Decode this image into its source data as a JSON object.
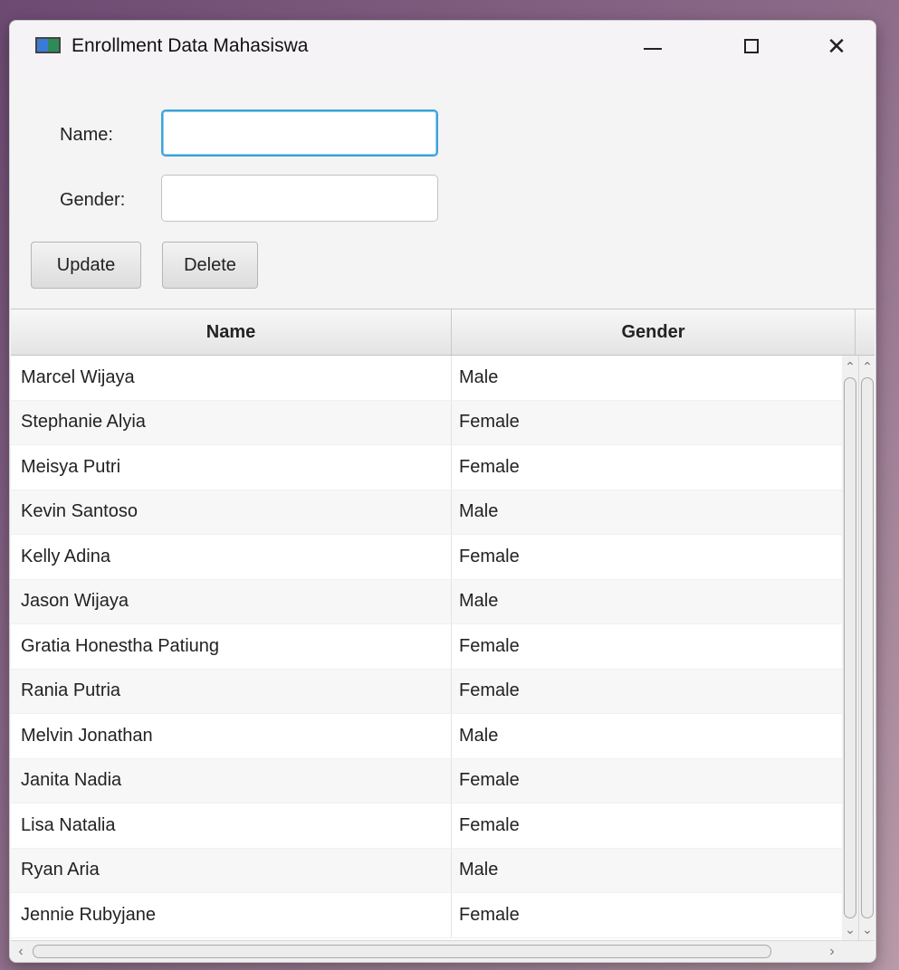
{
  "window": {
    "title": "Enrollment Data Mahasiswa",
    "minimize_glyph": "—",
    "maximize_glyph": "☐",
    "close_glyph": "✕"
  },
  "form": {
    "name_label": "Name:",
    "gender_label": "Gender:",
    "name_value": "",
    "gender_value": ""
  },
  "buttons": {
    "update_label": "Update",
    "delete_label": "Delete"
  },
  "table": {
    "columns": [
      "Name",
      "Gender"
    ],
    "rows": [
      {
        "name": "Marcel Wijaya",
        "gender": "Male"
      },
      {
        "name": "Stephanie Alyia",
        "gender": "Female"
      },
      {
        "name": "Meisya Putri",
        "gender": "Female"
      },
      {
        "name": "Kevin Santoso",
        "gender": "Male"
      },
      {
        "name": "Kelly Adina",
        "gender": "Female"
      },
      {
        "name": "Jason Wijaya",
        "gender": "Male"
      },
      {
        "name": "Gratia Honestha Patiung",
        "gender": "Female"
      },
      {
        "name": "Rania Putria",
        "gender": "Female"
      },
      {
        "name": "Melvin Jonathan",
        "gender": "Male"
      },
      {
        "name": "Janita Nadia",
        "gender": "Female"
      },
      {
        "name": "Lisa Natalia",
        "gender": "Female"
      },
      {
        "name": "Ryan Aria",
        "gender": "Male"
      },
      {
        "name": "Jennie Rubyjane",
        "gender": "Female"
      }
    ]
  },
  "icons": {
    "app": "app-window-icon",
    "scroll_up": "chevron-up-icon",
    "scroll_down": "chevron-down-icon",
    "scroll_left": "chevron-left-icon",
    "scroll_right": "chevron-right-icon"
  },
  "colors": {
    "focus_border": "#3fa3d9",
    "row_alt": "#f7f7f7",
    "header_bg": "#e4e4e4"
  }
}
